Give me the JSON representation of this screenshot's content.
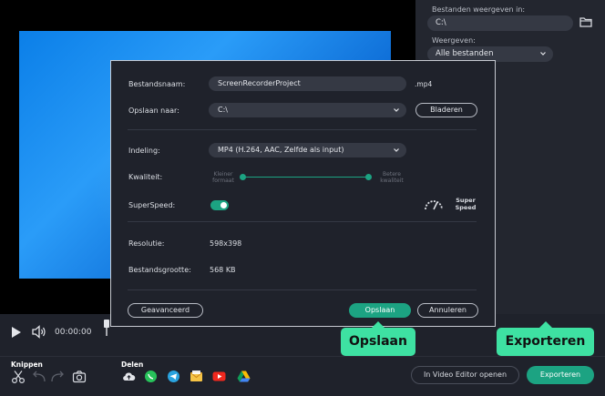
{
  "right_panel": {
    "show_files_label": "Bestanden weergeven in:",
    "show_files_value": "C:\\",
    "display_label": "Weergeven:",
    "display_value": "Alle bestanden"
  },
  "player": {
    "time": "00:00:00"
  },
  "bottom_bar": {
    "cut_label": "Knippen",
    "share_label": "Delen",
    "open_editor_label": "In Video Editor openen",
    "export_label": "Exporteren"
  },
  "dialog": {
    "filename_label": "Bestandsnaam:",
    "filename_value": "ScreenRecorderProject",
    "extension": ".mp4",
    "save_to_label": "Opslaan naar:",
    "save_to_value": "C:\\",
    "browse_label": "Bladeren",
    "format_label": "Indeling:",
    "format_value": "MP4 (H.264, AAC, Zelfde als input)",
    "quality_label": "Kwaliteit:",
    "quality_low_label": "Kleiner formaat",
    "quality_high_label": "Betere kwaliteit",
    "quality_level": 1.0,
    "superspeed_label": "SuperSpeed:",
    "superspeed_on": true,
    "super_speed_badge_line1": "Super",
    "super_speed_badge_line2": "Speed",
    "resolution_label": "Resolutie:",
    "resolution_value": "598x398",
    "filesize_label": "Bestandsgrootte:",
    "filesize_value": "568 KB",
    "advanced_label": "Geavanceerd",
    "save_label": "Opslaan",
    "cancel_label": "Annuleren"
  },
  "callouts": {
    "save": "Opslaan",
    "export": "Exporteren"
  },
  "colors": {
    "accent": "#1ca382",
    "callout": "#3ee1a2",
    "background": "#1f222b"
  }
}
